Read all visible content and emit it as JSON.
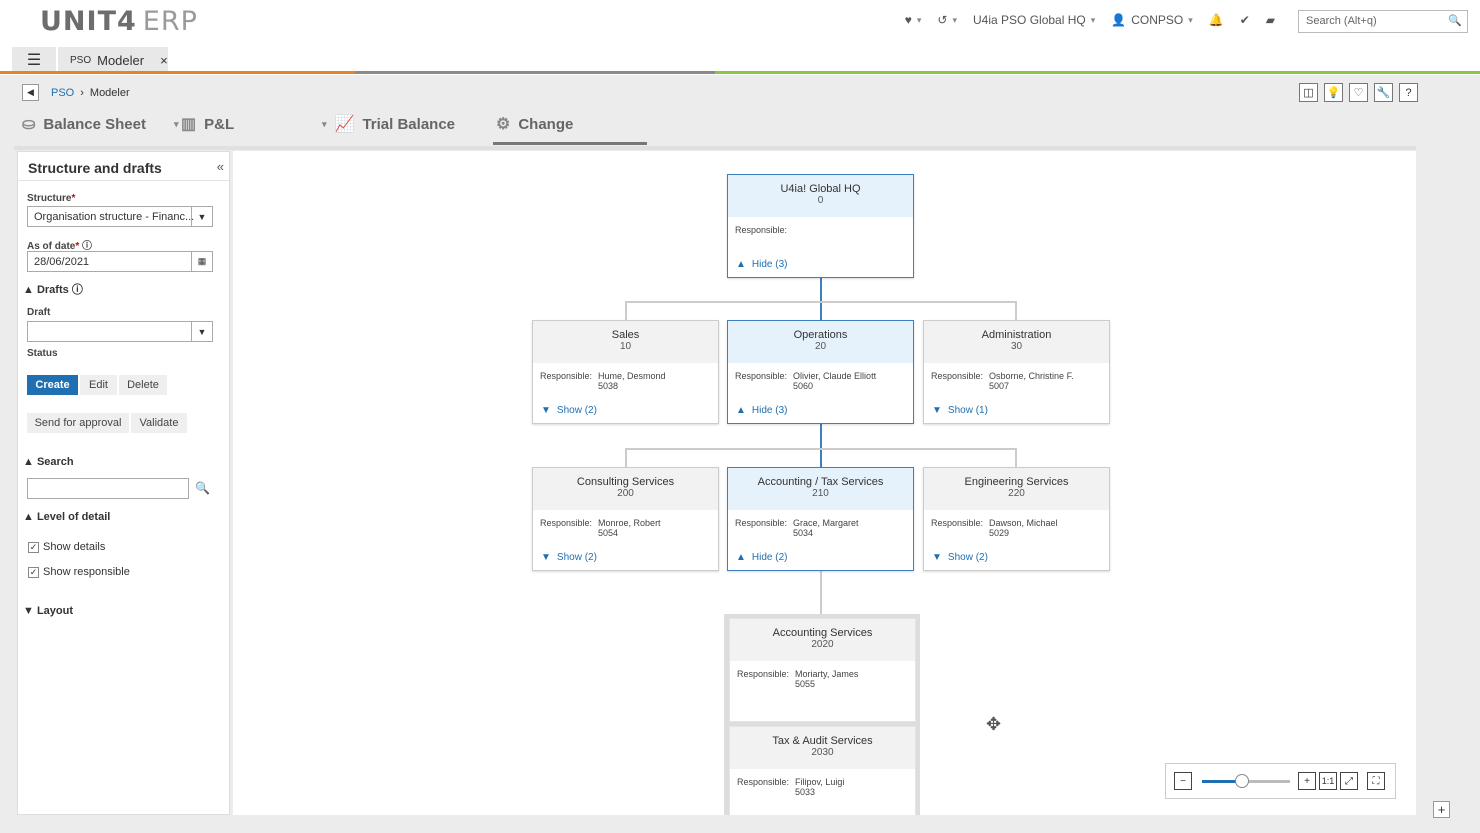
{
  "app": {
    "brand": "UNIT4",
    "product": "ERP"
  },
  "topnav": {
    "company": "U4ia PSO Global HQ",
    "user": "CONPSO",
    "search_placeholder": "Search (Alt+q)"
  },
  "tabbar": {
    "tab_prefix": "PSO",
    "tab_label": "Modeler",
    "close": "×"
  },
  "colors": {
    "accent": "#1f6fb2",
    "orange": "#e8832c",
    "grey": "#8a8a8a",
    "green": "#8dc63f"
  },
  "breadcrumb": {
    "root": "PSO",
    "sep": "›",
    "current": "Modeler"
  },
  "views": {
    "balance_sheet": "Balance Sheet",
    "pnl": "P&L",
    "trial_balance": "Trial Balance",
    "change": "Change"
  },
  "panel": {
    "title": "Structure and drafts",
    "structure_label": "Structure",
    "structure_value": "Organisation structure - Financ...",
    "as_of_label": "As of date",
    "as_of_value": "28/06/2021",
    "drafts_title": "Drafts",
    "draft_label": "Draft",
    "status_label": "Status",
    "create": "Create",
    "edit": "Edit",
    "delete": "Delete",
    "send": "Send for approval",
    "validate": "Validate",
    "search_title": "Search",
    "level_title": "Level of detail",
    "show_details": "Show details",
    "show_responsible": "Show responsible",
    "layout_title": "Layout"
  },
  "nodes": {
    "hq": {
      "name": "U4ia! Global HQ",
      "code": "0",
      "resp_label": "Responsible:",
      "resp_name": "",
      "resp_id": "",
      "toggle": "Hide (3)"
    },
    "sales": {
      "name": "Sales",
      "code": "10",
      "resp_label": "Responsible:",
      "resp_name": "Hume, Desmond",
      "resp_id": "5038",
      "toggle": "Show (2)"
    },
    "ops": {
      "name": "Operations",
      "code": "20",
      "resp_label": "Responsible:",
      "resp_name": "Olivier, Claude Elliott",
      "resp_id": "5060",
      "toggle": "Hide (3)"
    },
    "admin": {
      "name": "Administration",
      "code": "30",
      "resp_label": "Responsible:",
      "resp_name": "Osborne, Christine F.",
      "resp_id": "5007",
      "toggle": "Show (1)"
    },
    "consult": {
      "name": "Consulting Services",
      "code": "200",
      "resp_label": "Responsible:",
      "resp_name": "Monroe, Robert",
      "resp_id": "5054",
      "toggle": "Show (2)"
    },
    "acct": {
      "name": "Accounting / Tax Services",
      "code": "210",
      "resp_label": "Responsible:",
      "resp_name": "Grace, Margaret",
      "resp_id": "5034",
      "toggle": "Hide (2)"
    },
    "eng": {
      "name": "Engineering Services",
      "code": "220",
      "resp_label": "Responsible:",
      "resp_name": "Dawson, Michael",
      "resp_id": "5029",
      "toggle": "Show (2)"
    },
    "acctsvc": {
      "name": "Accounting Services",
      "code": "2020",
      "resp_label": "Responsible:",
      "resp_name": "Moriarty, James",
      "resp_id": "5055"
    },
    "taxaudit": {
      "name": "Tax & Audit Services",
      "code": "2030",
      "resp_label": "Responsible:",
      "resp_name": "Filipov, Luigi",
      "resp_id": "5033"
    }
  },
  "zoom": {
    "level": 0.45,
    "one_to_one": "1:1"
  }
}
